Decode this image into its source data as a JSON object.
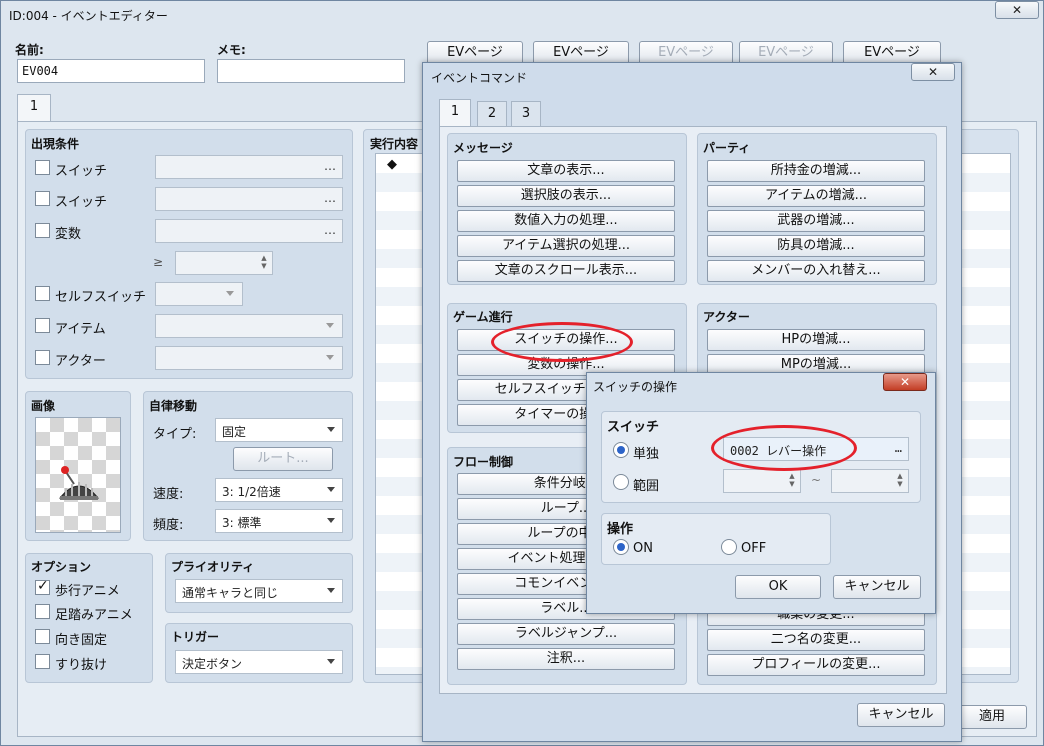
{
  "editor": {
    "title": "ID:004 - イベントエディター",
    "close_label": "✕",
    "name_label": "名前:",
    "name_value": "EV004",
    "memo_label": "メモ:",
    "memo_value": "",
    "page_buttons": [
      "EVページ",
      "EVページ",
      "EVページ",
      "EVページ",
      "EVページ"
    ],
    "page_tab": "1",
    "conditions_title": "出現条件",
    "cond_switch1": "スイッチ",
    "cond_switch2": "スイッチ",
    "cond_variable": "変数",
    "cond_selfswitch": "セルフスイッチ",
    "cond_item": "アイテム",
    "cond_actor": "アクター",
    "ge_symbol": "≥",
    "image_title": "画像",
    "automove_title": "自律移動",
    "type_label": "タイプ:",
    "type_value": "固定",
    "route_button": "ルート...",
    "speed_label": "速度:",
    "speed_value": "3: 1/2倍速",
    "freq_label": "頻度:",
    "freq_value": "3: 標準",
    "options_title": "オプション",
    "opt_walk": "歩行アニメ",
    "opt_step": "足踏みアニメ",
    "opt_dirfix": "向き固定",
    "opt_through": "すり抜け",
    "priority_title": "プライオリティ",
    "priority_value": "通常キャラと同じ",
    "trigger_title": "トリガー",
    "trigger_value": "決定ボタン",
    "contents_title": "実行内容",
    "contents_first": "◆",
    "apply_button": "適用",
    "dots": "…"
  },
  "command_window": {
    "title": "イベントコマンド",
    "close_label": "✕",
    "tabs": [
      "1",
      "2",
      "3"
    ],
    "message_title": "メッセージ",
    "message_buttons": [
      "文章の表示...",
      "選択肢の表示...",
      "数値入力の処理...",
      "アイテム選択の処理...",
      "文章のスクロール表示..."
    ],
    "party_title": "パーティ",
    "party_buttons": [
      "所持金の増減...",
      "アイテムの増減...",
      "武器の増減...",
      "防具の増減...",
      "メンバーの入れ替え..."
    ],
    "progress_title": "ゲーム進行",
    "progress_buttons": [
      "スイッチの操作...",
      "変数の操作...",
      "セルフスイッチの操作...",
      "タイマーの操作..."
    ],
    "actor_title": "アクター",
    "actor_buttons": [
      "HPの増減...",
      "MPの増減..."
    ],
    "flow_title": "フロー制御",
    "flow_buttons": [
      "条件分岐...",
      "ループ...",
      "ループの中断",
      "イベント処理の中断",
      "コモンイベント...",
      "ラベル...",
      "ラベルジャンプ...",
      "注釈..."
    ],
    "actor_lower_buttons": [
      "職業の変更...",
      "二つ名の変更...",
      "プロフィールの変更..."
    ],
    "cancel_button": "キャンセル"
  },
  "switch_dialog": {
    "title": "スイッチの操作",
    "close_label": "✕",
    "switch_title": "スイッチ",
    "single_label": "単独",
    "single_value": "0002 レバー操作",
    "range_label": "範囲",
    "tilde": "~",
    "operation_title": "操作",
    "on_label": "ON",
    "off_label": "OFF",
    "ok_button": "OK",
    "cancel_button": "キャンセル",
    "dots": "…"
  },
  "colors": {
    "highlight_ellipse": "#e4212b",
    "radio_selected": "#2d64c8"
  }
}
